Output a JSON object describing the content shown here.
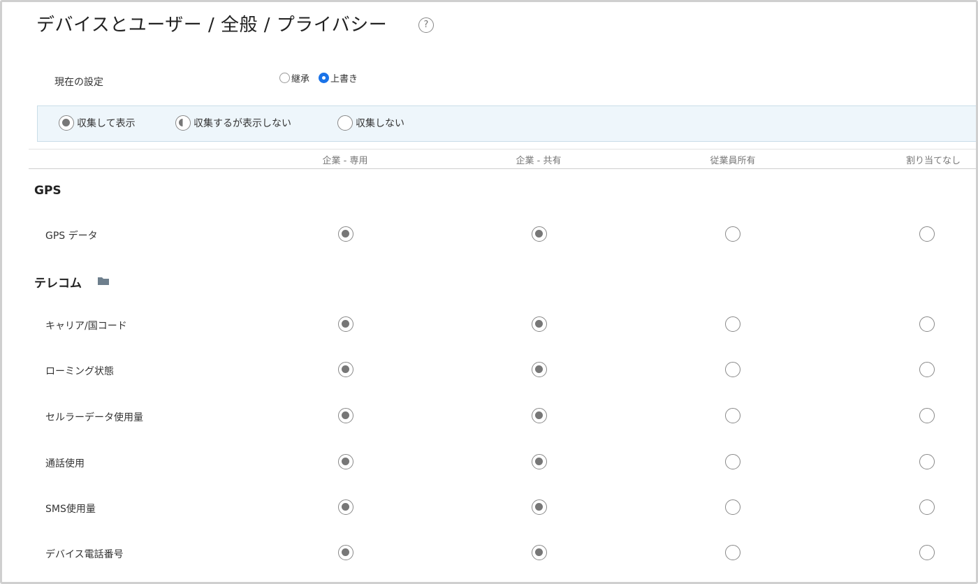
{
  "page": {
    "title": "デバイスとユーザー / 全般 / プライバシー",
    "help_icon": "?"
  },
  "current_setting": {
    "label": "現在の設定",
    "options": [
      {
        "label": "継承",
        "selected": false
      },
      {
        "label": "上書き",
        "selected": true
      }
    ]
  },
  "legend": [
    {
      "label": "収集して表示",
      "icon": "full"
    },
    {
      "label": "収集するが表示しない",
      "icon": "half"
    },
    {
      "label": "収集しない",
      "icon": "empty"
    }
  ],
  "columns": [
    "企業 - 専用",
    "企業 - 共有",
    "従業員所有",
    "割り当てなし"
  ],
  "sections": [
    {
      "title": "GPS",
      "folder_icon": false,
      "rows": [
        {
          "label": "GPS データ",
          "values": [
            true,
            true,
            false,
            false
          ]
        }
      ]
    },
    {
      "title": "テレコム",
      "folder_icon": true,
      "rows": [
        {
          "label": "キャリア/国コード",
          "values": [
            true,
            true,
            false,
            false
          ]
        },
        {
          "label": "ローミング状態",
          "values": [
            true,
            true,
            false,
            false
          ]
        },
        {
          "label": "セルラーデータ使用量",
          "values": [
            true,
            true,
            false,
            false
          ]
        },
        {
          "label": "通話使用",
          "values": [
            true,
            true,
            false,
            false
          ]
        },
        {
          "label": "SMS使用量",
          "values": [
            true,
            true,
            false,
            false
          ]
        },
        {
          "label": "デバイス電話番号",
          "values": [
            true,
            true,
            false,
            false
          ]
        }
      ]
    }
  ]
}
